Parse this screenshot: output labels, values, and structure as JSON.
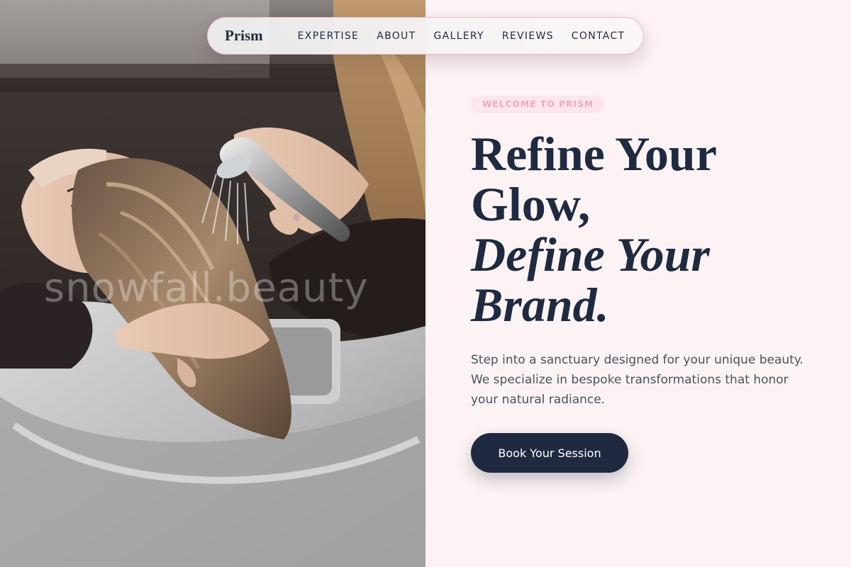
{
  "nav": {
    "brand": "Prism",
    "links": [
      "EXPERTISE",
      "ABOUT",
      "GALLERY",
      "REVIEWS",
      "CONTACT"
    ]
  },
  "hero": {
    "badge": "WELCOME TO PRISM",
    "headline_line1": "Refine Your",
    "headline_line2": "Glow,",
    "headline_italic1": "Define Your",
    "headline_italic2": "Brand.",
    "description": "Step into a sanctuary designed for your unique beauty. We specialize in bespoke transformations that honor your natural radiance.",
    "cta_label": "Book Your Session"
  },
  "photo": {
    "watermark": "snowfall.beauty"
  },
  "colors": {
    "navy": "#1e2a40",
    "blush": "#fdf3f4",
    "pink_accent": "#f0a8bc"
  }
}
